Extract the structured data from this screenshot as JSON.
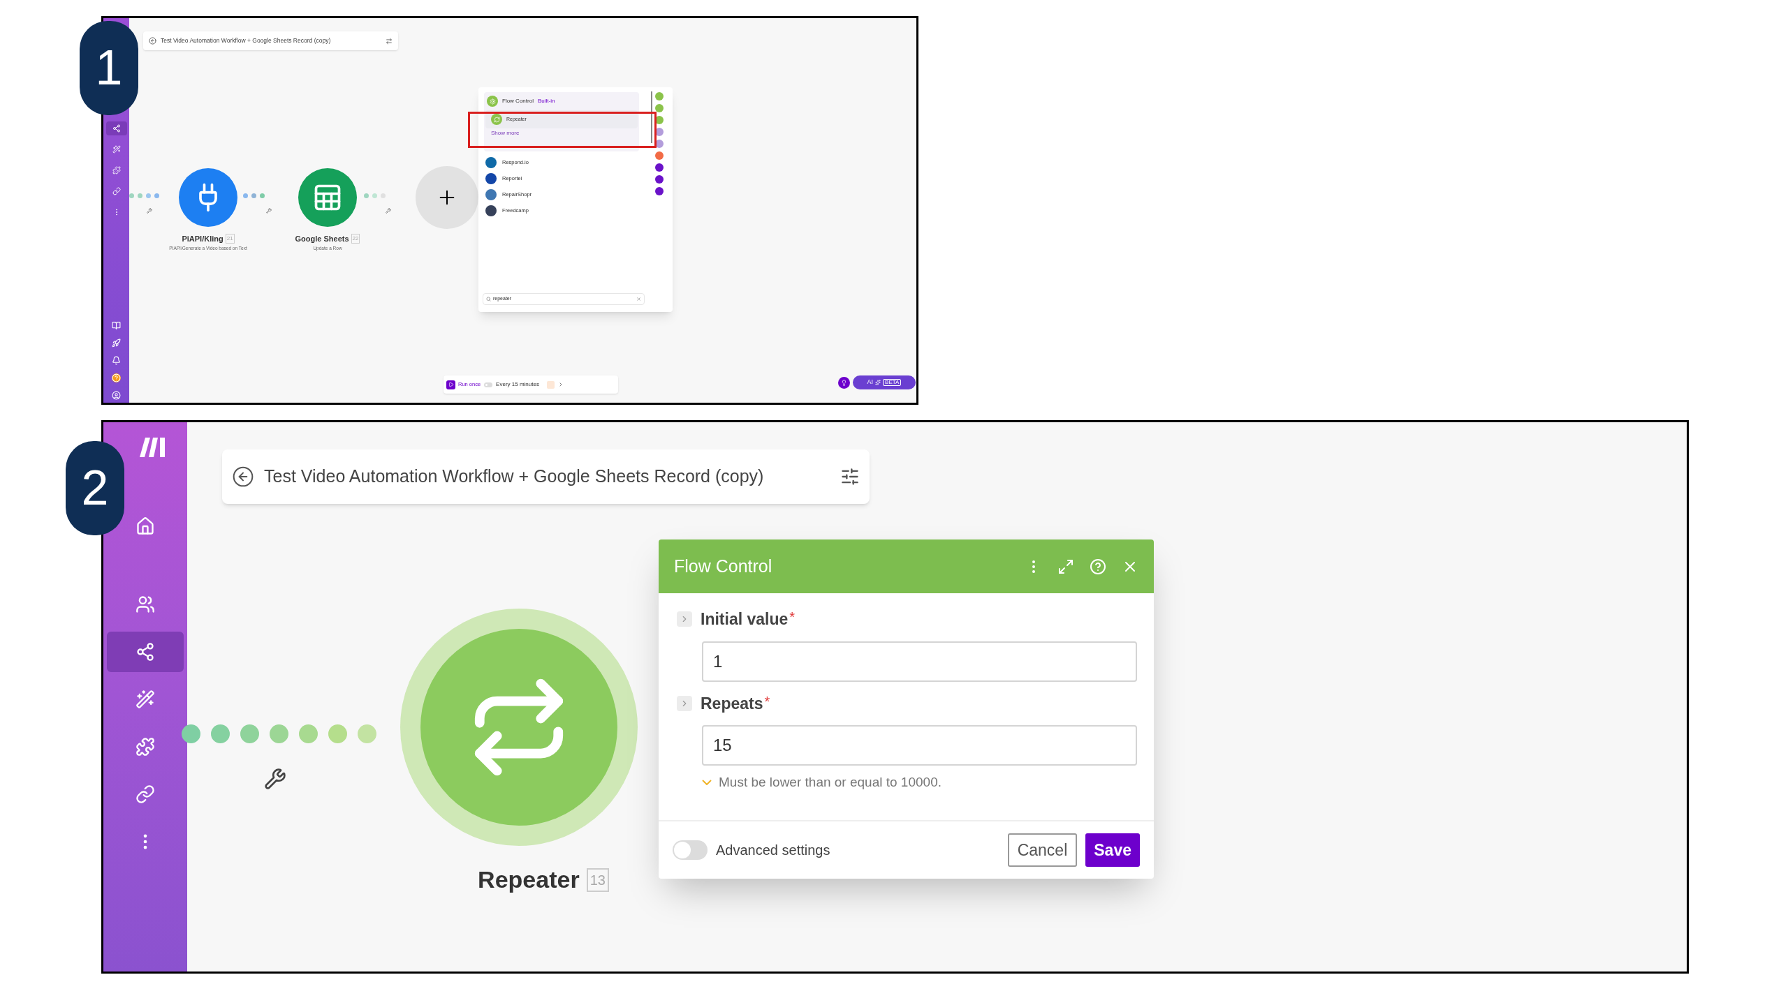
{
  "callouts": [
    {
      "label": "1"
    },
    {
      "label": "2"
    }
  ],
  "step_1": {
    "title_bar": {
      "title": "Test Video Automation Workflow + Google Sheets Record (copy)"
    },
    "sidebar": {
      "top_items": [
        {
          "kind": "share",
          "selected": true
        },
        {
          "kind": "ai",
          "selected": false
        },
        {
          "kind": "puzzle",
          "selected": false
        },
        {
          "kind": "link",
          "selected": false
        },
        {
          "kind": "more",
          "selected": false
        }
      ],
      "bottom_items": [
        {
          "kind": "book"
        },
        {
          "kind": "rocket"
        },
        {
          "kind": "bell"
        },
        {
          "kind": "help"
        },
        {
          "kind": "avatar"
        }
      ]
    },
    "nodes": [
      {
        "kind": "plug",
        "name": "PiAPI/Kling",
        "number": "21",
        "subtitle": "PIAPI/Generate a Video based on Text",
        "color": "#1d7ff2"
      },
      {
        "kind": "sheet",
        "name": "Google Sheets",
        "number": "22",
        "subtitle": "Update a Row",
        "color": "#15a05a"
      }
    ],
    "module_picker": {
      "featured": {
        "app": "Flow Control",
        "tag": "Built-in",
        "module": "Repeater",
        "link": "Show more"
      },
      "apps": [
        {
          "name": "Respond.io",
          "color": "#0f6aa8"
        },
        {
          "name": "Reportei",
          "color": "#1346a8"
        },
        {
          "name": "RepairShopr",
          "color": "#3f77b2"
        },
        {
          "name": "Freedcamp",
          "color": "#36415a"
        }
      ],
      "rail": [
        {
          "color": "#8bc34a"
        },
        {
          "color": "#8bc34a"
        },
        {
          "color": "#8bc34a"
        },
        {
          "color": "#b39ddb"
        },
        {
          "color": "#b39ddb"
        },
        {
          "color": "#f26b46"
        },
        {
          "color": "#6a12c9"
        },
        {
          "color": "#6a12c9"
        },
        {
          "color": "#6a12c9"
        }
      ],
      "search": {
        "value": "repeater"
      }
    },
    "toolbar": {
      "run_button": "Run once",
      "schedule": {
        "on": false,
        "label": "Every 15 minutes"
      },
      "ai_button": {
        "label": "AI",
        "tag": "BETA"
      }
    }
  },
  "step_2": {
    "title_bar": {
      "title": "Test Video Automation Workflow + Google Sheets Record (copy)"
    },
    "sidebar": {
      "items": [
        {
          "kind": "home",
          "selected": false
        },
        {
          "kind": "team",
          "selected": false
        },
        {
          "kind": "share",
          "selected": true
        },
        {
          "kind": "ai",
          "selected": false
        },
        {
          "kind": "puzzle",
          "selected": false
        },
        {
          "kind": "link",
          "selected": false
        },
        {
          "kind": "more",
          "selected": false
        }
      ]
    },
    "node": {
      "name": "Repeater",
      "number": "13"
    },
    "dialog": {
      "title": "Flow Control",
      "fields": [
        {
          "label": "Initial value",
          "required_mark": "*",
          "value": "1"
        },
        {
          "label": "Repeats",
          "required_mark": "*",
          "value": "15",
          "hint": "Must be lower than or equal to 10000."
        }
      ],
      "advanced": {
        "label": "Advanced settings",
        "on": false
      },
      "buttons": [
        {
          "label": "Cancel",
          "kind": "secondary"
        },
        {
          "label": "Save",
          "kind": "primary"
        }
      ]
    }
  }
}
